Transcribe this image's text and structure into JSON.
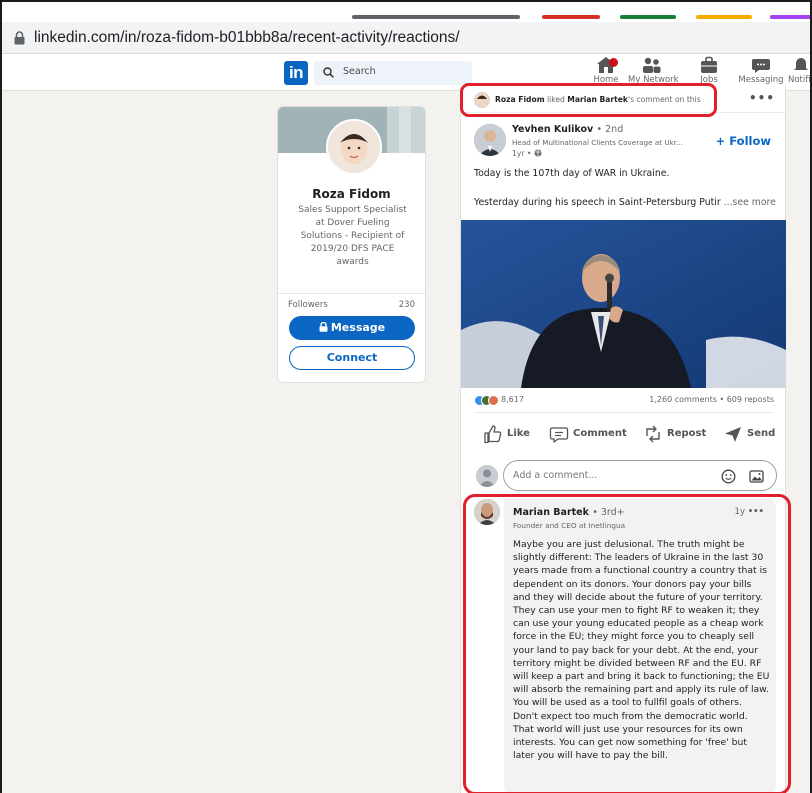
{
  "browser": {
    "url": "linkedin.com/in/roza-fidom-b01bbb8a/recent-activity/reactions/",
    "tab_colors": [
      "#5f6368",
      "#d93025",
      "#188038",
      "#f9ab00",
      "#a142f4"
    ]
  },
  "linkedin_nav": {
    "logo": "in",
    "search_placeholder": "Search",
    "items": [
      {
        "label": "Home",
        "icon": "home-icon"
      },
      {
        "label": "My Network",
        "icon": "network-icon"
      },
      {
        "label": "Jobs",
        "icon": "briefcase-icon"
      },
      {
        "label": "Messaging",
        "icon": "messaging-icon"
      },
      {
        "label": "Notifi",
        "icon": "bell-icon"
      }
    ]
  },
  "profile_card": {
    "name": "Roza Fidom",
    "headline_lines": [
      "Sales Support Specialist",
      "at Dover Fueling",
      "Solutions - Recipient of",
      "2019/20 DFS PACE",
      "awards"
    ],
    "followers_label": "Followers",
    "followers_count": "230",
    "message_label": "Message",
    "connect_label": "Connect"
  },
  "post": {
    "activity": {
      "actor": "Roza Fidom",
      "verb": "liked",
      "target": "Marian Bartek",
      "suffix": "'s comment on this",
      "more": "•••"
    },
    "author": {
      "name": "Yevhen Kulikov",
      "degree": "• 2nd",
      "headline": "Head of Multinational Clients Coverage at Ukr...",
      "time": "1yr •",
      "follow_label": "+ Follow"
    },
    "text_line1": "Today is the 107th day of WAR in Ukraine.",
    "text_line2": "Yesterday during his speech in Saint-Petersburg Putir",
    "see_more": "...see more",
    "reaction_count": "8,617",
    "comments_reposts": "1,260 comments • 609 reposts",
    "actions": {
      "like": "Like",
      "comment": "Comment",
      "repost": "Repost",
      "send": "Send"
    },
    "comment_placeholder": "Add a comment..."
  },
  "comment": {
    "author": "Marian Bartek",
    "degree": "• 3rd+",
    "headline": "Founder and CEO at Inetlingua",
    "time": "1y",
    "more": "•••",
    "lines": [
      "Maybe you are just delusional. The truth might be",
      "slightly different: The leaders of Ukraine in the last 30",
      "years made from a functional country a country that is",
      "dependent on its donors. Your donors pay your bills",
      "and they will decide about the future of your territory.",
      "They can use your men to fight RF to weaken it; they",
      "can use your young educated people as a cheap work",
      "force in the EU; they might force you to cheaply sell",
      "your land to pay back for your debt. At the end, your",
      "territory might be divided between RF and the EU. RF",
      "will keep a part and bring it back to functioning; the EU",
      "will absorb the remaining part and apply its rule of law.",
      "You will be used as a tool to fullfil goals of others.",
      "Don't expect too much from the democratic world.",
      "That world will just use your resources for its own",
      "interests. You can get now something for 'free' but",
      "later you will have to pay the bill."
    ]
  },
  "colors": {
    "linkedin_blue": "#0a66c2",
    "annotation_red": "#e0202a",
    "page_background": "#f4f2ee"
  }
}
